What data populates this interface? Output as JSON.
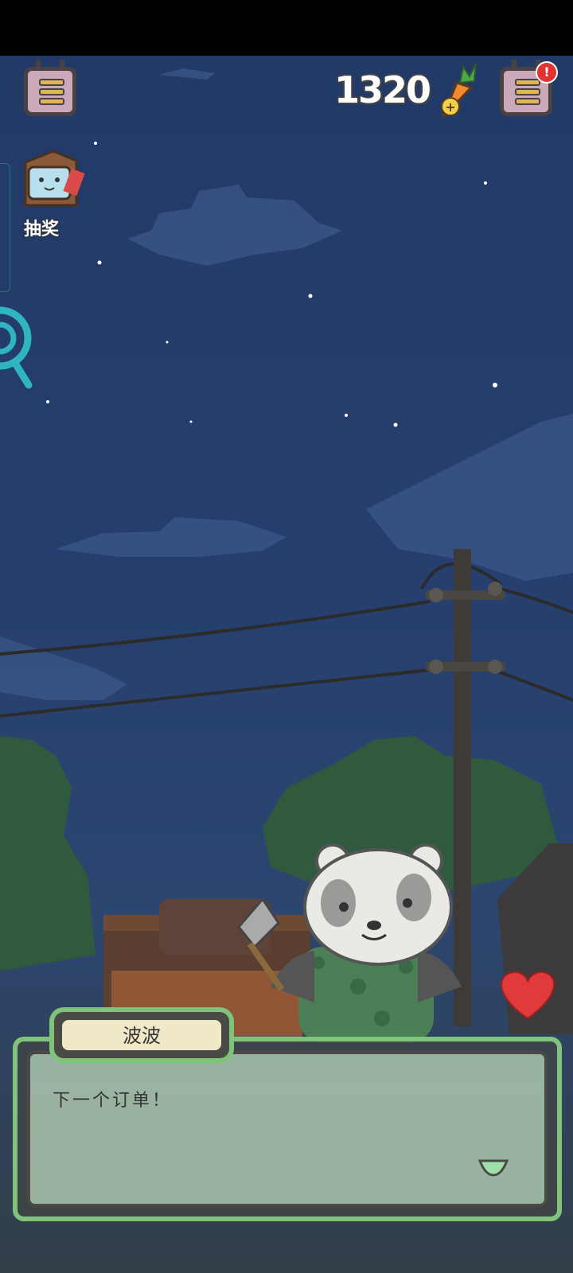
{
  "header": {
    "currency_amount": "1320",
    "currency_icon": "carrot-plus-icon",
    "left_menu_icon": "menu-list-icon",
    "right_menu_icon": "menu-list-icon",
    "notification_badge": "!"
  },
  "sidebar": {
    "lottery_label": "抽奖",
    "lottery_icon": "lottery-box-icon",
    "swirl_icon": "swirl-icon"
  },
  "dialog": {
    "speaker_name": "波波",
    "message": "下一个订单！",
    "continue_icon": "continue-arrow-icon"
  },
  "colors": {
    "sky": "#223a67",
    "dialog_border": "#7fc47a",
    "badge": "#e1332f",
    "heart": "#e23a3a"
  }
}
